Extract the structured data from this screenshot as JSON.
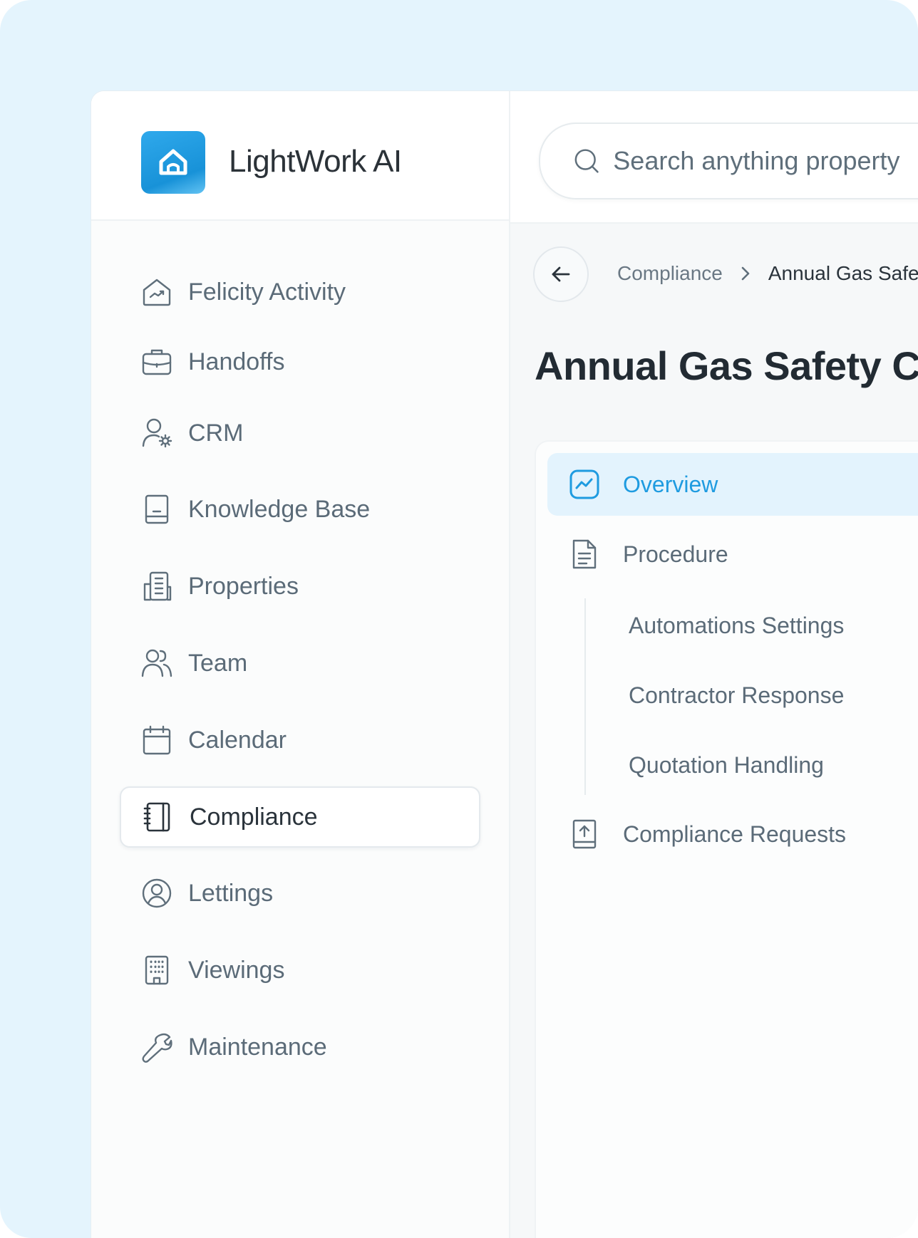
{
  "app": {
    "name": "LightWork AI",
    "logo_icon": "home-icon",
    "accent_color": "#1f9ee3"
  },
  "sidebar": {
    "items": [
      {
        "label": "Felicity Activity",
        "icon": "house-chart-icon",
        "active": false
      },
      {
        "label": "Handoffs",
        "icon": "briefcase-icon",
        "active": false
      },
      {
        "label": "CRM",
        "icon": "user-gear-icon",
        "active": false
      },
      {
        "label": "Knowledge Base",
        "icon": "book-icon",
        "active": false
      },
      {
        "label": "Properties",
        "icon": "buildings-icon",
        "active": false
      },
      {
        "label": "Team",
        "icon": "users-icon",
        "active": false
      },
      {
        "label": "Calendar",
        "icon": "calendar-icon",
        "active": false
      },
      {
        "label": "Compliance",
        "icon": "notebook-icon",
        "active": true
      },
      {
        "label": "Lettings",
        "icon": "user-circle-icon",
        "active": false
      },
      {
        "label": "Viewings",
        "icon": "building-icon",
        "active": false
      },
      {
        "label": "Maintenance",
        "icon": "wrench-icon",
        "active": false
      }
    ]
  },
  "search": {
    "placeholder": "Search anything property"
  },
  "breadcrumb": {
    "parent": "Compliance",
    "current": "Annual Gas Safety Check"
  },
  "page": {
    "title": "Annual Gas Safety Check"
  },
  "subnav": {
    "overview": {
      "label": "Overview",
      "icon": "chart-icon",
      "active": true
    },
    "procedure": {
      "label": "Procedure",
      "icon": "document-icon",
      "children": [
        "Automations Settings",
        "Contractor Response",
        "Quotation Handling"
      ]
    },
    "requests": {
      "label": "Compliance Requests",
      "icon": "upload-book-icon"
    }
  }
}
